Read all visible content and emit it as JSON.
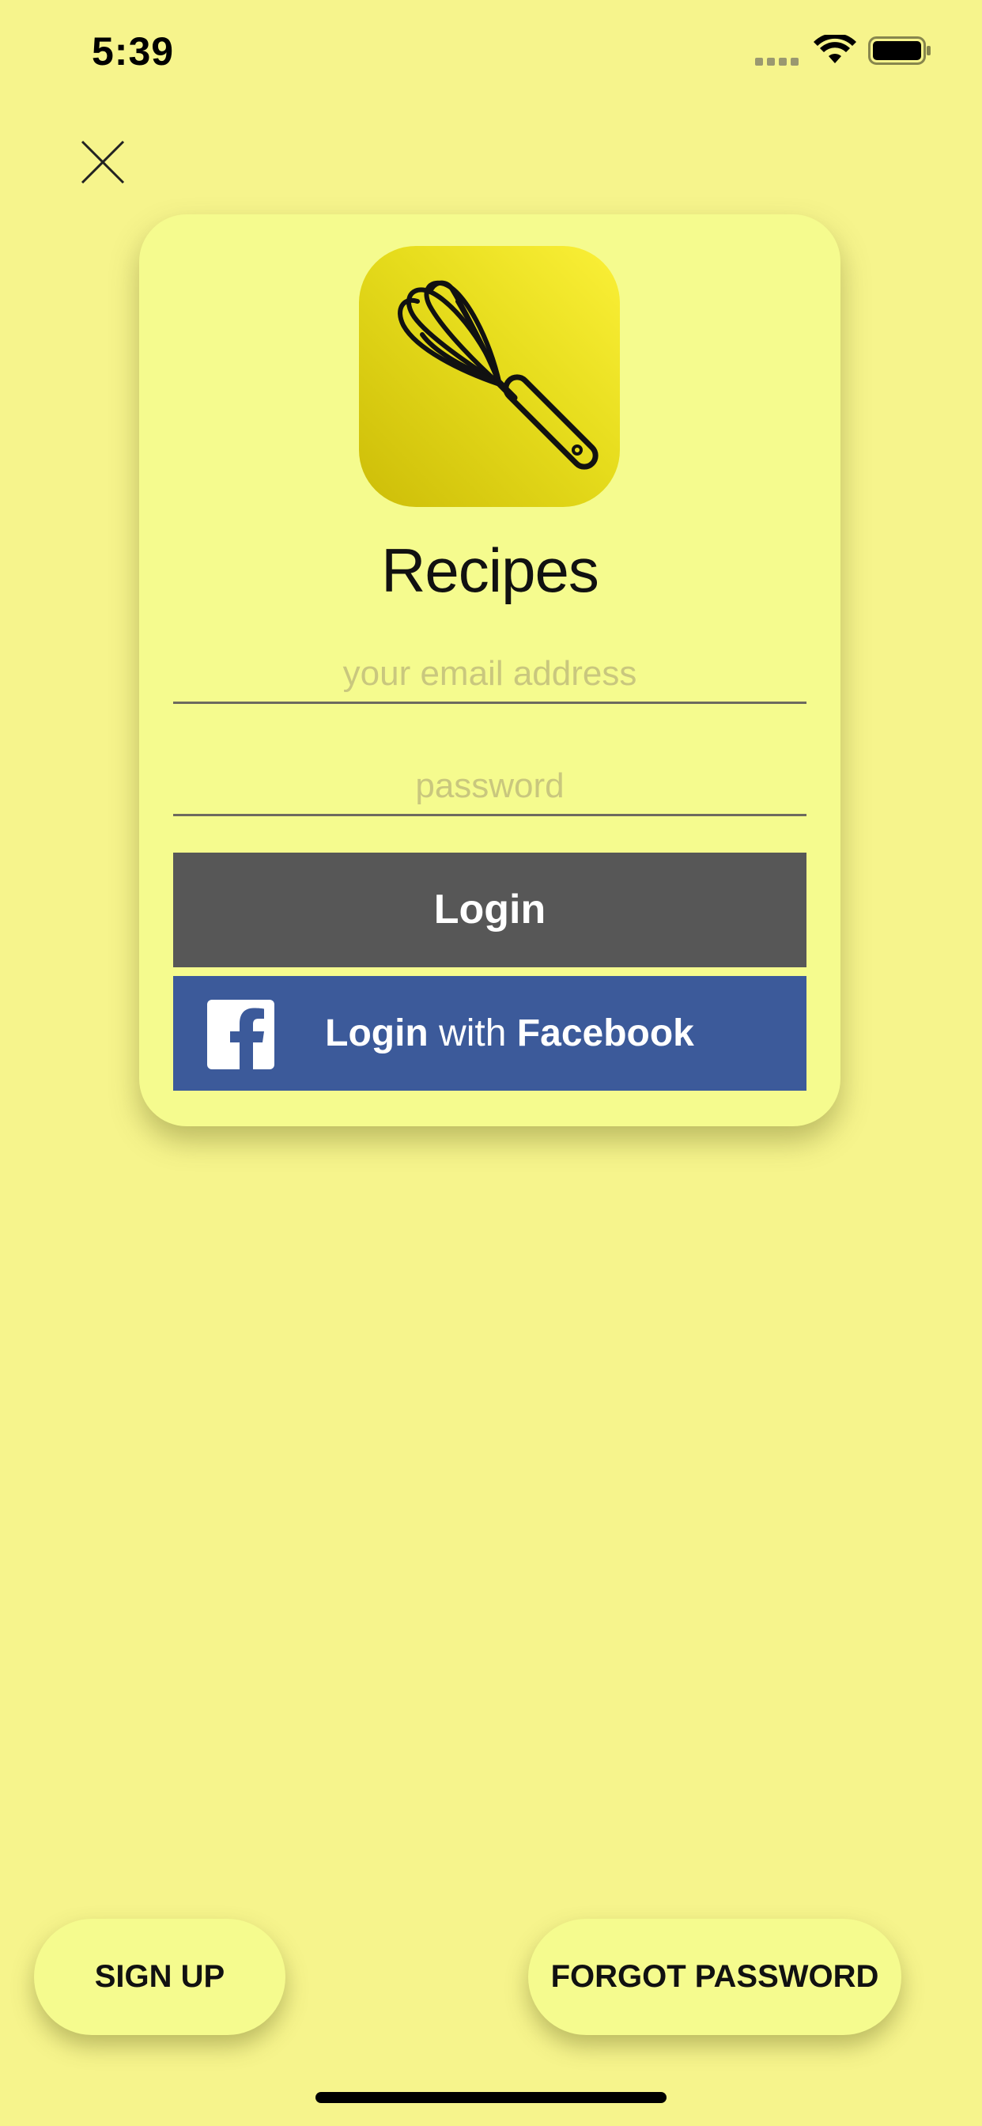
{
  "status_bar": {
    "time": "5:39",
    "signal_icon": "cellular-signal-icon",
    "wifi_icon": "wifi-icon",
    "battery_icon": "battery-icon"
  },
  "close_icon": "close-icon",
  "card": {
    "app_icon": "whisk-icon",
    "title": "Recipes",
    "email_placeholder": "your email address",
    "password_placeholder": "password",
    "login_label": "Login",
    "facebook": {
      "icon": "facebook-logo-icon",
      "prefix": "Login",
      "middle": "with",
      "brand": "Facebook"
    }
  },
  "footer": {
    "signup_label": "SIGN UP",
    "forgot_label": "FORGOT PASSWORD"
  },
  "colors": {
    "background": "#f6f48c",
    "card": "#f5fb8e",
    "login_button": "#575757",
    "facebook_button": "#3c5a9a"
  }
}
